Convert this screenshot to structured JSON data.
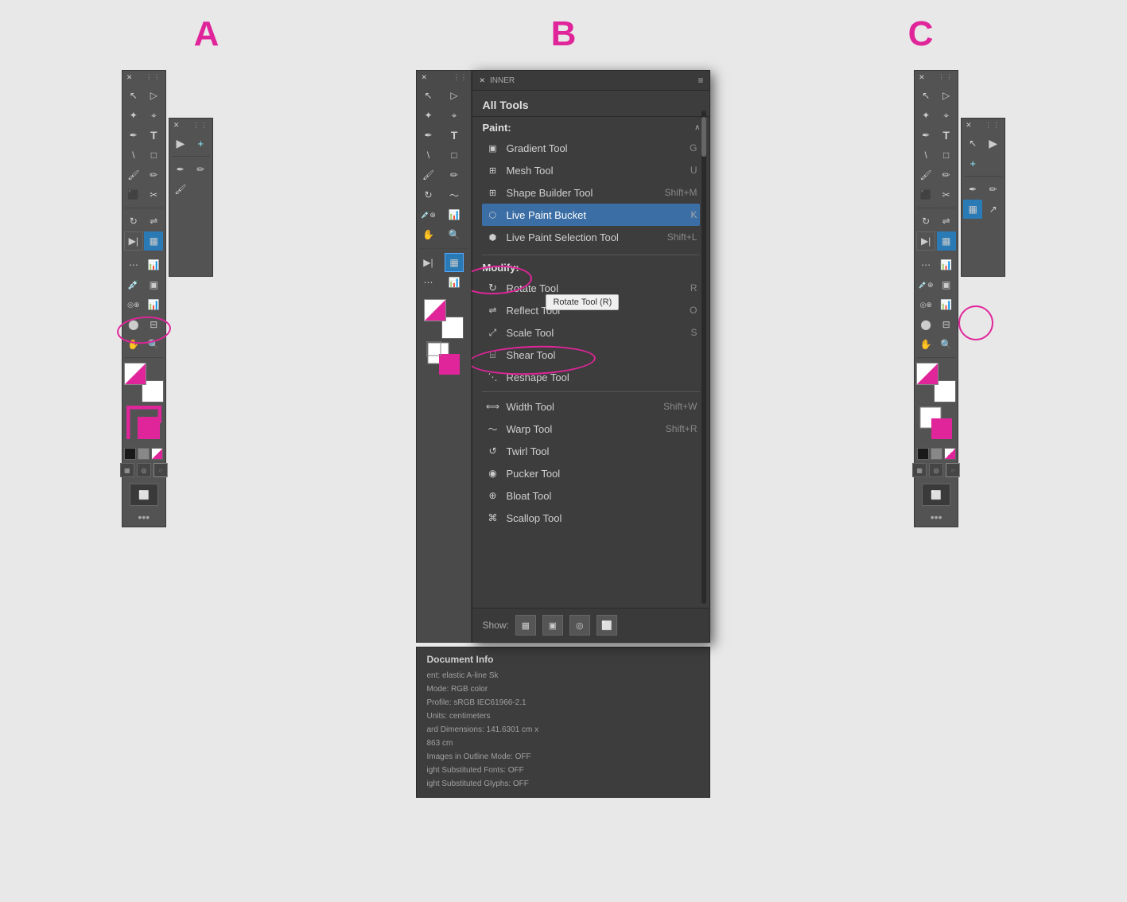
{
  "labels": {
    "a": "A",
    "b": "B",
    "c": "C"
  },
  "allToolsPanel": {
    "title": "All Tools",
    "sections": {
      "paint": {
        "label": "Paint:",
        "tools": [
          {
            "name": "Gradient Tool",
            "shortcut": "G",
            "icon": "gradient"
          },
          {
            "name": "Mesh Tool",
            "shortcut": "U",
            "icon": "mesh"
          },
          {
            "name": "Shape Builder Tool",
            "shortcut": "Shift+M",
            "icon": "builder"
          },
          {
            "name": "Live Paint Bucket",
            "shortcut": "K",
            "icon": "livepaint",
            "active": true
          },
          {
            "name": "Live Paint Selection Tool",
            "shortcut": "Shift+L",
            "icon": "livepaintsel"
          }
        ]
      },
      "modify": {
        "label": "Modify:",
        "tools": [
          {
            "name": "Rotate Tool",
            "shortcut": "R",
            "icon": "rotate",
            "active": true
          },
          {
            "name": "Reflect Tool",
            "shortcut": "O",
            "icon": "reflect"
          },
          {
            "name": "Scale Tool",
            "shortcut": "S",
            "icon": "scale"
          },
          {
            "name": "Shear Tool",
            "shortcut": "",
            "icon": "shear"
          },
          {
            "name": "Reshape Tool",
            "shortcut": "",
            "icon": "reshape"
          },
          {
            "name": "Width Tool",
            "shortcut": "Shift+W",
            "icon": "width"
          },
          {
            "name": "Warp Tool",
            "shortcut": "Shift+R",
            "icon": "warp"
          },
          {
            "name": "Twirl Tool",
            "shortcut": "",
            "icon": "twirl"
          },
          {
            "name": "Pucker Tool",
            "shortcut": "",
            "icon": "pucker"
          },
          {
            "name": "Bloat Tool",
            "shortcut": "",
            "icon": "bloat"
          },
          {
            "name": "Scallop Tool",
            "shortcut": "",
            "icon": "scallop"
          }
        ]
      }
    },
    "tooltip": "Rotate Tool (R)",
    "footer": {
      "show_label": "Show:",
      "icons": [
        "grid",
        "panel",
        "circle",
        "artboard"
      ]
    }
  },
  "docInfo": {
    "title": "Document Info",
    "content_label": "ent:",
    "content_value": "elastic A-line Sk",
    "mode": "Mode: RGB color",
    "profile": "Profile: sRGB IEC61966-2.1",
    "units": "Units: centimeters",
    "dimensions": "ard Dimensions: 141.6301 cm x",
    "dimensions2": "863 cm",
    "images": "Images in Outline Mode: OFF",
    "fonts": "ight Substituted Fonts: OFF",
    "glyphs": "ight Substituted Glyphs: OFF"
  }
}
